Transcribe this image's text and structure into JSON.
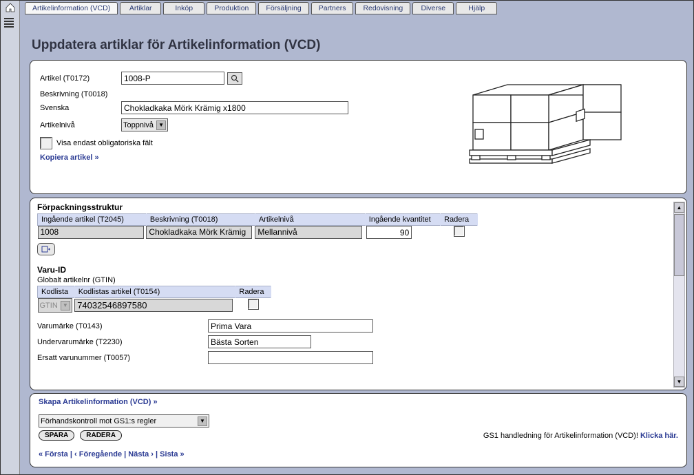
{
  "tabs": [
    {
      "label": "Artikelinformation (VCD)",
      "active": true
    },
    {
      "label": "Artiklar"
    },
    {
      "label": "Inköp"
    },
    {
      "label": "Produktion"
    },
    {
      "label": "Försäljning"
    },
    {
      "label": "Partners"
    },
    {
      "label": "Redovisning"
    },
    {
      "label": "Diverse"
    },
    {
      "label": "Hjälp"
    }
  ],
  "page_title": "Uppdatera artiklar för Artikelinformation (VCD)",
  "form": {
    "artikel_label": "Artikel (T0172)",
    "artikel_value": "1008-P",
    "beskrivning_label": "Beskrivning (T0018)",
    "svenska_label": "Svenska",
    "svenska_value": "Chokladkaka Mörk Krämig x1800",
    "niva_label": "Artikelnivå",
    "niva_value": "Toppnivå",
    "obl_label": "Visa endast obligatoriska fält",
    "kopiera_link": "Kopiera artikel »"
  },
  "struct": {
    "title": "Förpackningsstruktur",
    "cols": {
      "c1": "Ingående artikel (T2045)",
      "c2": "Beskrivning (T0018)",
      "c3": "Artikelnivå",
      "c4": "Ingående kvantitet",
      "c5": "Radera"
    },
    "row": {
      "artikel": "1008",
      "beskr": "Chokladkaka Mörk Krämig",
      "niva": "Mellannivå",
      "kvant": "90"
    }
  },
  "varuid": {
    "title": "Varu-ID",
    "sub": "Globalt artikelnr (GTIN)",
    "cols": {
      "c1": "Kodlista",
      "c2": "Kodlistas artikel (T0154)",
      "c3": "Radera"
    },
    "row": {
      "kod": "GTIN",
      "art": "74032546897580"
    }
  },
  "extra": {
    "varumarke_label": "Varumärke (T0143)",
    "varumarke_value": "Prima Vara",
    "under_label": "Undervarumärke (T2230)",
    "under_value": "Bästa Sorten",
    "ersatt_label": "Ersatt varunummer (T0057)",
    "ersatt_value": ""
  },
  "footer": {
    "skapa_link": "Skapa Artikelinformation (VCD) »",
    "forhands_value": "Förhandskontroll mot GS1:s regler",
    "spara": "SPARA",
    "radera": "RADERA",
    "gs1_text": "GS1 handledning för Artikelinformation (VCD)! ",
    "gs1_link": "Klicka här.",
    "nav_first": "« Första",
    "nav_prev": "‹ Föregående",
    "nav_next": "Nästa ›",
    "nav_last": "Sista »",
    "nav_sep": " | "
  }
}
